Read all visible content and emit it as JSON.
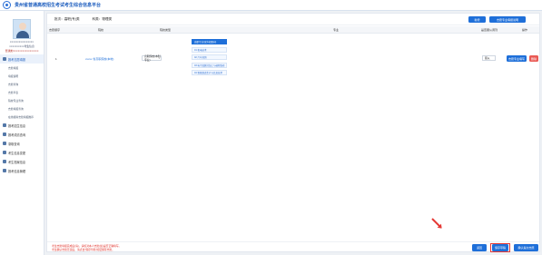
{
  "app": {
    "title": "贵州省普通高校招生考试考生综合信息平台"
  },
  "profile": {
    "line1": "××××××××××××××××",
    "line2": "××××××××××考生信息",
    "line3": "普通类/×××××××××××××××××"
  },
  "sidebar": {
    "groups": [
      {
        "label": "报考志愿填报",
        "open": true,
        "items": [
          "志愿填报",
          "填报说明",
          "志愿查询",
          "志愿草表",
          "院校专业查询",
          "志愿填报查询",
          "在线模拟志愿填报推荐"
        ]
      },
      {
        "label": "报考招生信息"
      },
      {
        "label": "报考成绩查询"
      },
      {
        "label": "录取查询"
      },
      {
        "label": "考生信息变更"
      },
      {
        "label": "考生档案信息"
      },
      {
        "label": "报考信息管理"
      }
    ]
  },
  "filter": {
    "batch": "批次：高职(专)类",
    "type": "科类：物理类"
  },
  "toolbar": {
    "new_label": "新增",
    "profession_label": "志愿专业填报说明"
  },
  "table": {
    "headers": [
      "志愿顺序",
      "院校",
      "院校类型",
      "专业",
      "是否服从调剂",
      "操作"
    ],
    "row": {
      "order": "1",
      "school": "xxxxx 省高职院校(本地)",
      "type_select": "高职院校(本科专业)",
      "majors": [
        "高职专业(含外招面向)",
        "01 机电技术",
        "02 汽车营销",
        "03 电子及数控加工与编程维修",
        "04 智能制造生产与信息技术"
      ],
      "obey": "服从",
      "action_primary": "志愿专业填写",
      "action_delete": "删除"
    }
  },
  "footer": {
    "note1": "考生志愿填报完成后(请)，请核对本人志愿(如)是否正确填写。",
    "note2": "考生确认志愿无误后，请点击“保存草稿”按钮保存志愿。",
    "prev_label": "返回",
    "save_label": "保存草稿",
    "submit_label": "确认提交志愿"
  },
  "colors": {
    "accent": "#1e6fd9",
    "danger": "#e53935"
  }
}
